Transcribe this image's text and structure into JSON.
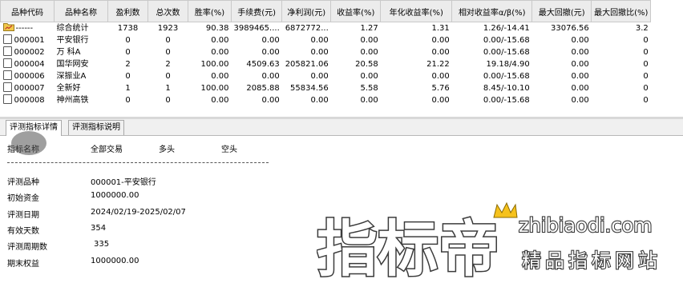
{
  "table": {
    "headers": [
      "品种代码",
      "品种名称",
      "盈利数",
      "总次数",
      "胜率(%)",
      "手续费(元)",
      "净利润(元)",
      "收益率(%)",
      "年化收益率(%)",
      "相对收益率α/β(%)",
      "最大回撤(元)",
      "最大回撤比(%)"
    ],
    "rows": [
      {
        "code": "------",
        "name": "综合统计",
        "wins": "1738",
        "total": "1923",
        "winrate": "90.38",
        "fee": "3989465....",
        "net": "6872772...",
        "ret": "1.27",
        "annual": "1.31",
        "rel": "1.26/-14.41",
        "mdd": "33076.56",
        "mddr": "3.2",
        "icon": "folder-chart-icon"
      },
      {
        "code": "000001",
        "name": "平安银行",
        "wins": "0",
        "total": "0",
        "winrate": "0.00",
        "fee": "0.00",
        "net": "0.00",
        "ret": "0.00",
        "annual": "0.00",
        "rel": "0.00/-15.68",
        "mdd": "0.00",
        "mddr": "0",
        "icon": "document-icon"
      },
      {
        "code": "000002",
        "name": "万 科A",
        "wins": "0",
        "total": "0",
        "winrate": "0.00",
        "fee": "0.00",
        "net": "0.00",
        "ret": "0.00",
        "annual": "0.00",
        "rel": "0.00/-15.68",
        "mdd": "0.00",
        "mddr": "0",
        "icon": "document-icon"
      },
      {
        "code": "000004",
        "name": "国华网安",
        "wins": "2",
        "total": "2",
        "winrate": "100.00",
        "fee": "4509.63",
        "net": "205821.06",
        "ret": "20.58",
        "annual": "21.22",
        "rel": "19.18/4.90",
        "mdd": "0.00",
        "mddr": "0",
        "icon": "document-icon"
      },
      {
        "code": "000006",
        "name": "深振业A",
        "wins": "0",
        "total": "0",
        "winrate": "0.00",
        "fee": "0.00",
        "net": "0.00",
        "ret": "0.00",
        "annual": "0.00",
        "rel": "0.00/-15.68",
        "mdd": "0.00",
        "mddr": "0",
        "icon": "document-icon"
      },
      {
        "code": "000007",
        "name": "全新好",
        "wins": "1",
        "total": "1",
        "winrate": "100.00",
        "fee": "2085.88",
        "net": "55834.56",
        "ret": "5.58",
        "annual": "5.76",
        "rel": "8.45/-10.10",
        "mdd": "0.00",
        "mddr": "0",
        "icon": "document-icon"
      },
      {
        "code": "000008",
        "name": "神州高铁",
        "wins": "0",
        "total": "0",
        "winrate": "0.00",
        "fee": "0.00",
        "net": "0.00",
        "ret": "0.00",
        "annual": "0.00",
        "rel": "0.00/-15.68",
        "mdd": "0.00",
        "mddr": "0",
        "icon": "document-icon"
      }
    ]
  },
  "tabs": [
    "评测指标详情",
    "评测指标说明"
  ],
  "stats": {
    "columns": [
      "指标名称",
      "全部交易",
      "多头",
      "空头"
    ],
    "rows": [
      {
        "label": "评测品种",
        "value": "000001-平安银行"
      },
      {
        "label": "初始资金",
        "value": "1000000.00"
      },
      {
        "label": "评测日期",
        "value": "2024/02/19-2025/02/07"
      },
      {
        "label": "有效天数",
        "value": "354"
      },
      {
        "label": "评测周期数",
        "value": "335"
      },
      {
        "label": "期末权益",
        "value": "1000000.00"
      }
    ]
  },
  "watermark": {
    "main_text": "指标帝",
    "url_text": "zhibiaodi.com",
    "slogan": "精品指标网站",
    "text_color": "#ffffff",
    "outline_color": "#3a3a3a"
  }
}
